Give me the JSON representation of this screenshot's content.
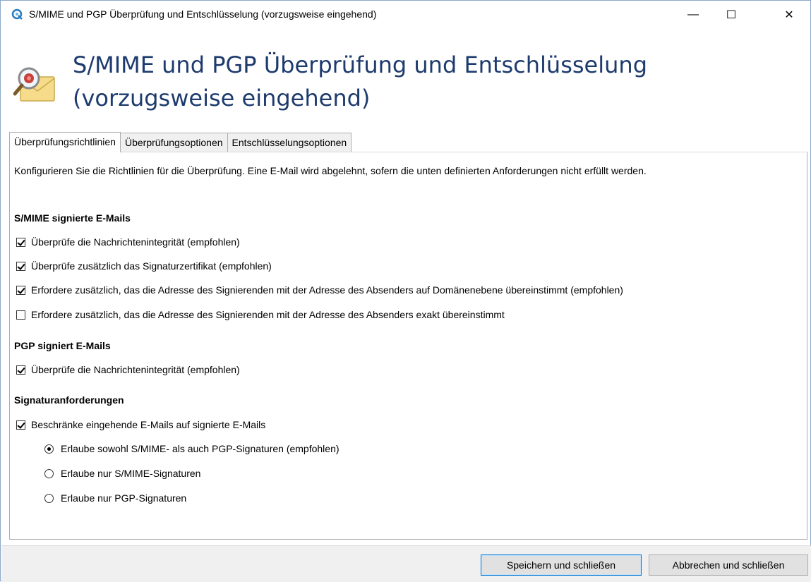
{
  "window": {
    "title": "S/MIME und PGP Überprüfung und Entschlüsselung (vorzugsweise eingehend)",
    "controls": {
      "minimize": "—",
      "maximize": "☐",
      "close": "✕"
    }
  },
  "header": {
    "title": "S/MIME und PGP Überprüfung und Entschlüsselung (vorzugsweise eingehend)",
    "icon": "mail-seal-magnifier-icon"
  },
  "tabs": [
    {
      "label": "Überprüfungsrichtlinien",
      "active": true
    },
    {
      "label": "Überprüfungsoptionen",
      "active": false
    },
    {
      "label": "Entschlüsselungsoptionen",
      "active": false
    }
  ],
  "panel": {
    "description": "Konfigurieren Sie die Richtlinien für die Überprüfung. Eine E-Mail wird abgelehnt, sofern die unten definierten Anforderungen nicht erfüllt werden.",
    "smime": {
      "heading": "S/MIME signierte E-Mails",
      "options": [
        {
          "label": "Überprüfe die Nachrichtenintegrität (empfohlen)",
          "checked": true
        },
        {
          "label": "Überprüfe zusätzlich das Signaturzertifikat (empfohlen)",
          "checked": true
        },
        {
          "label": "Erfordere zusätzlich, das die Adresse des Signierenden mit der Adresse des Absenders auf Domänenebene übereinstimmt (empfohlen)",
          "checked": true
        },
        {
          "label": "Erfordere zusätzlich, das die Adresse des Signierenden mit der Adresse des Absenders exakt übereinstimmt",
          "checked": false
        }
      ]
    },
    "pgp": {
      "heading": "PGP signiert E-Mails",
      "options": [
        {
          "label": "Überprüfe die Nachrichtenintegrität (empfohlen)",
          "checked": true
        }
      ]
    },
    "signature": {
      "heading": "Signaturanforderungen",
      "restrict": {
        "label": "Beschränke eingehende E-Mails auf signierte E-Mails",
        "checked": true
      },
      "radios": [
        {
          "label": "Erlaube sowohl S/MIME- als auch PGP-Signaturen (empfohlen)",
          "selected": true
        },
        {
          "label": "Erlaube nur S/MIME-Signaturen",
          "selected": false
        },
        {
          "label": "Erlaube nur PGP-Signaturen",
          "selected": false
        }
      ]
    }
  },
  "footer": {
    "save_label": "Speichern und schließen",
    "cancel_label": "Abbrechen und schließen"
  }
}
